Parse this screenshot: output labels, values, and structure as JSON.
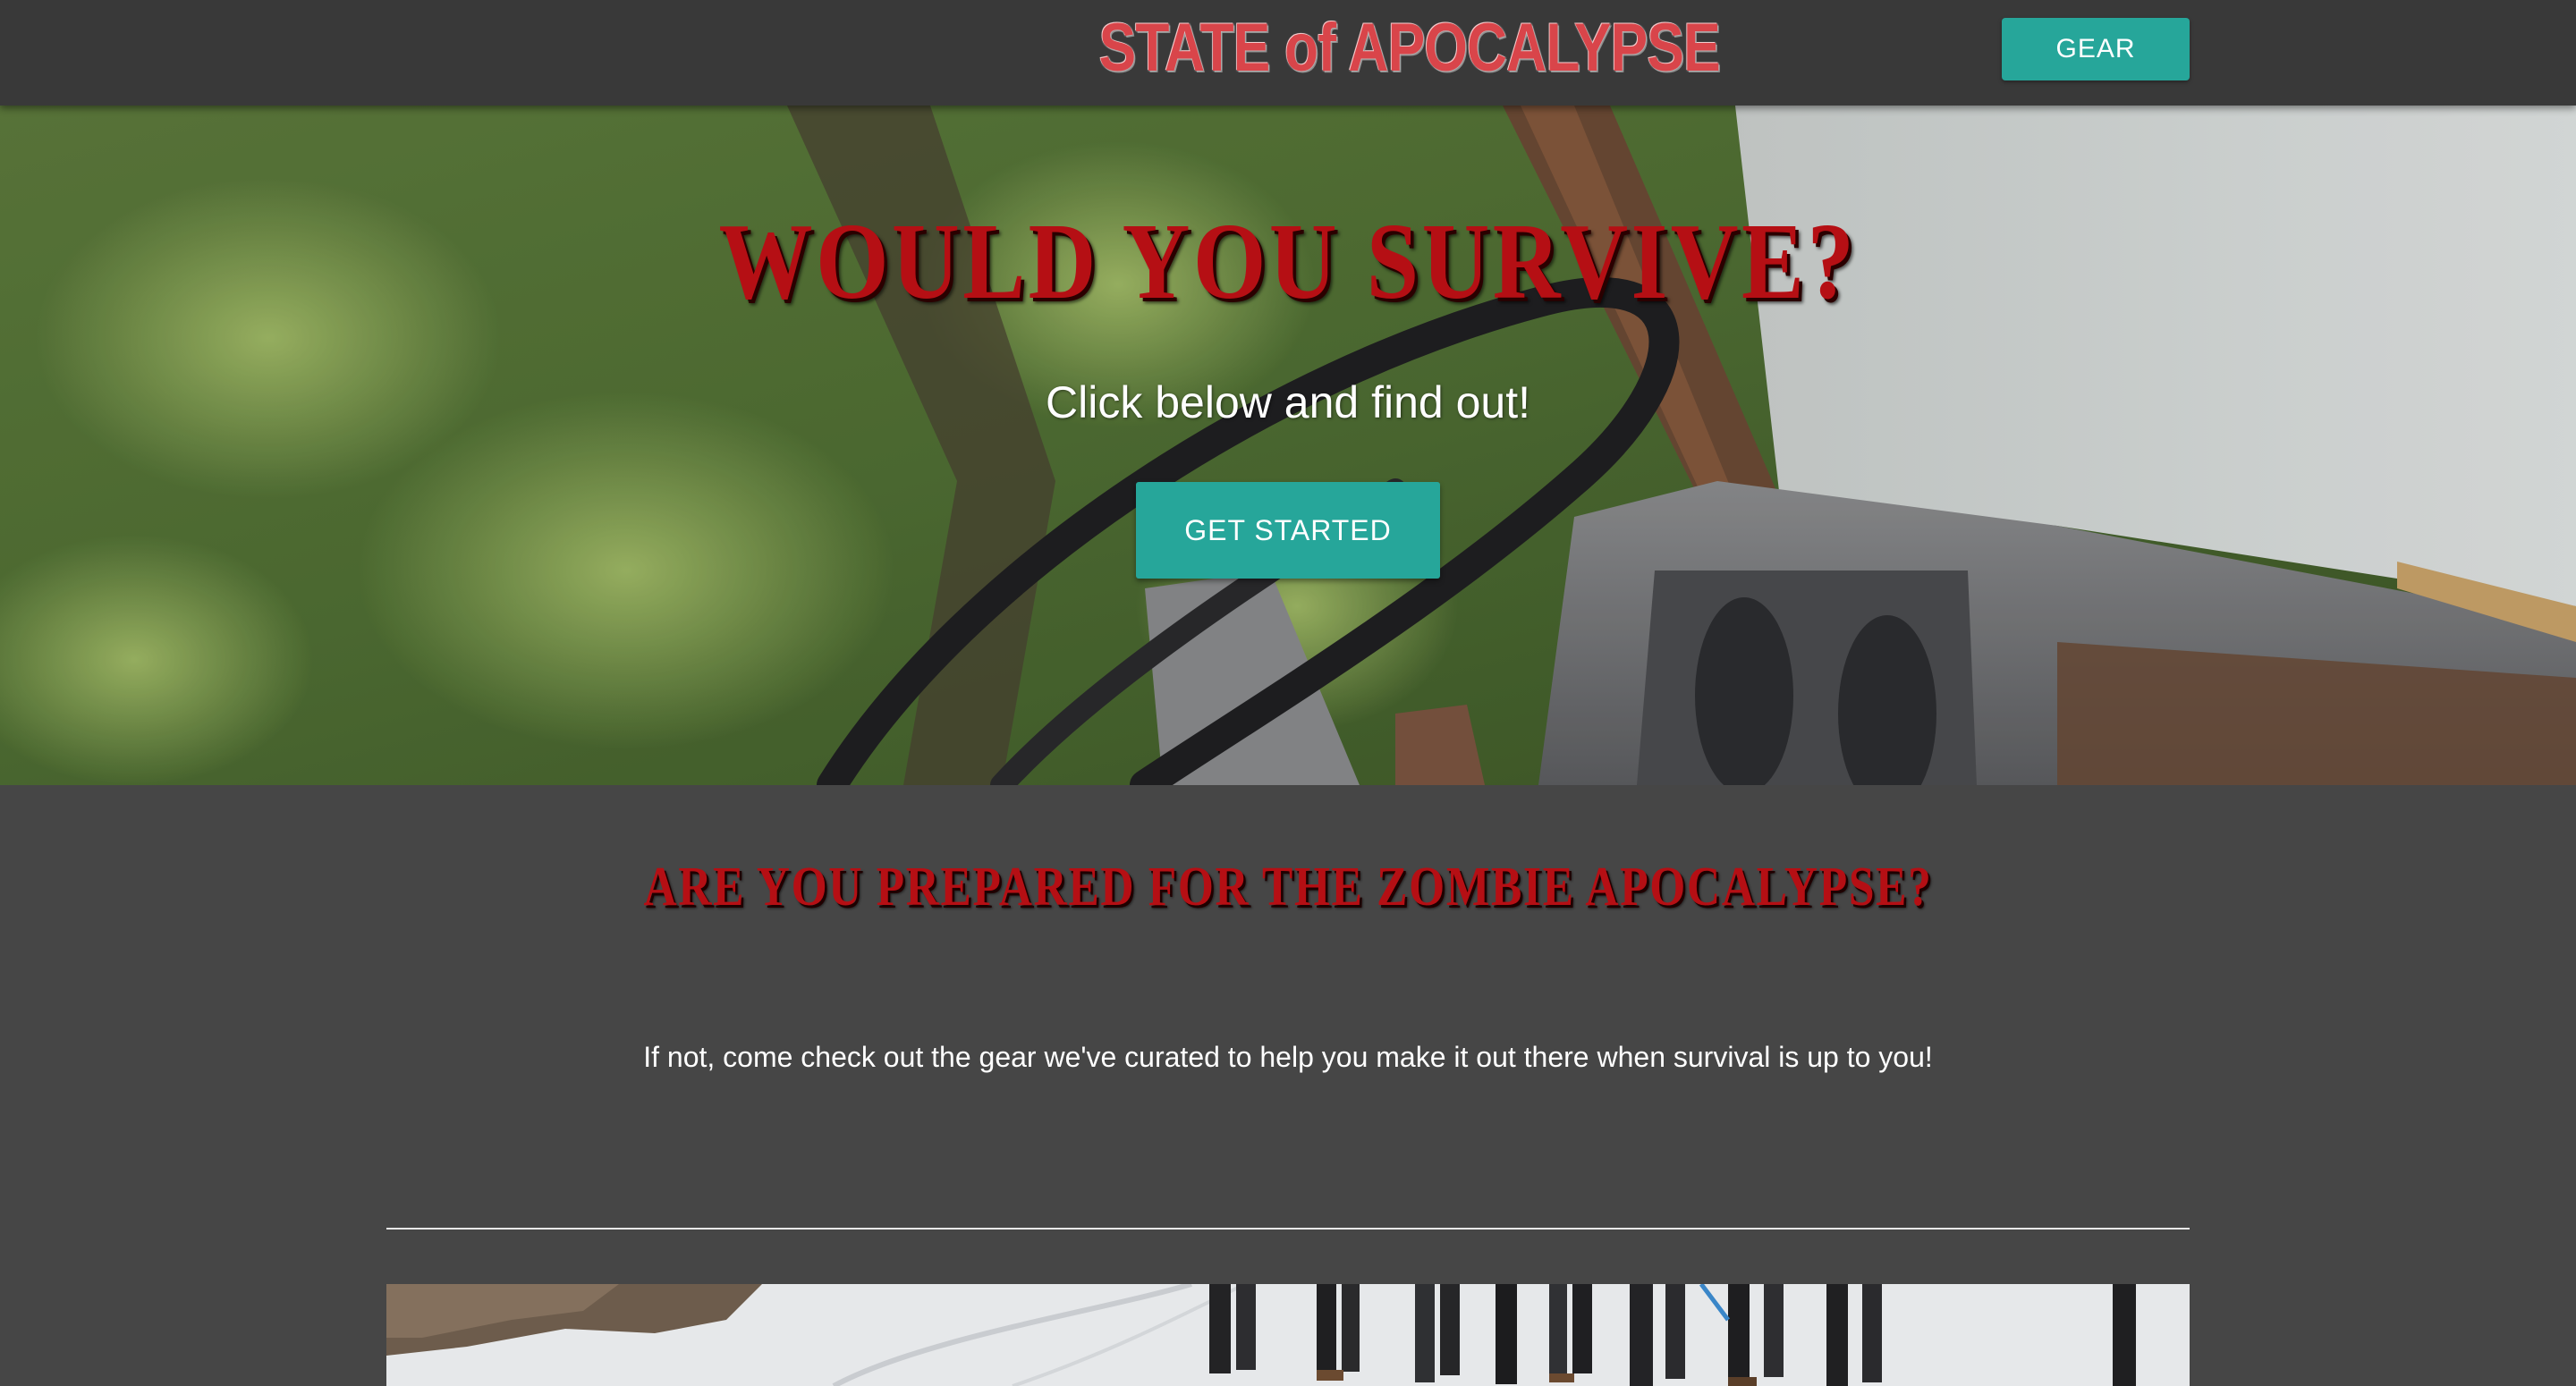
{
  "navbar": {
    "brand": "STATE of APOCALYPSE",
    "gear_label": "GEAR"
  },
  "hero": {
    "title": "WOULD YOU SURVIVE?",
    "subtitle": "Click below and find out!",
    "cta_label": "GET STARTED"
  },
  "content": {
    "heading": "ARE YOU PREPARED FOR THE ZOMBIE APOCALYPSE?",
    "body": "If not, come check out the gear we've curated to help you make it out there when survival is up to you!"
  },
  "colors": {
    "navbar_bg": "#393939",
    "page_bg": "#464646",
    "accent_teal": "#26a69a",
    "blood_red": "#b50f14",
    "brand_red": "#d9454a"
  }
}
